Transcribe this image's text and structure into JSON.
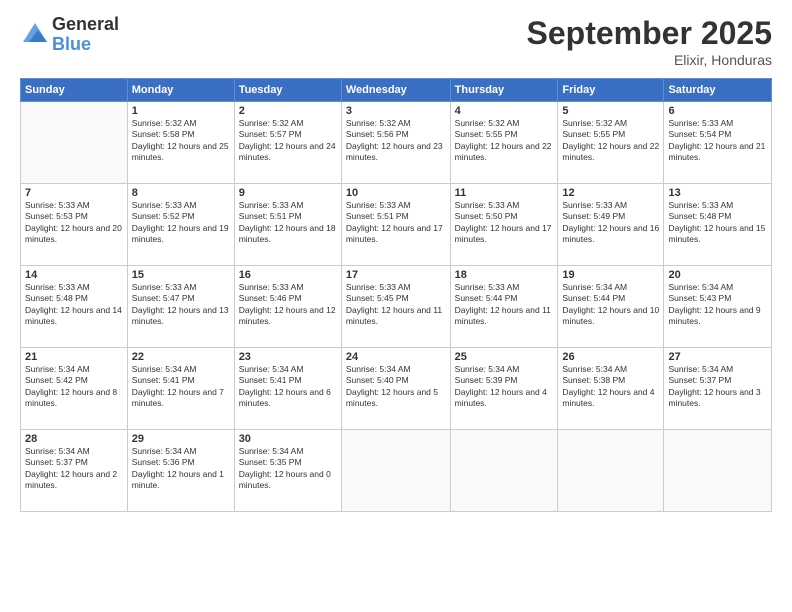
{
  "header": {
    "logo": {
      "general": "General",
      "blue": "Blue"
    },
    "title": "September 2025",
    "location": "Elixir, Honduras"
  },
  "weekdays": [
    "Sunday",
    "Monday",
    "Tuesday",
    "Wednesday",
    "Thursday",
    "Friday",
    "Saturday"
  ],
  "weeks": [
    [
      {
        "day": null
      },
      {
        "day": 1,
        "sunrise": "5:32 AM",
        "sunset": "5:58 PM",
        "daylight": "12 hours and 25 minutes."
      },
      {
        "day": 2,
        "sunrise": "5:32 AM",
        "sunset": "5:57 PM",
        "daylight": "12 hours and 24 minutes."
      },
      {
        "day": 3,
        "sunrise": "5:32 AM",
        "sunset": "5:56 PM",
        "daylight": "12 hours and 23 minutes."
      },
      {
        "day": 4,
        "sunrise": "5:32 AM",
        "sunset": "5:55 PM",
        "daylight": "12 hours and 22 minutes."
      },
      {
        "day": 5,
        "sunrise": "5:32 AM",
        "sunset": "5:55 PM",
        "daylight": "12 hours and 22 minutes."
      },
      {
        "day": 6,
        "sunrise": "5:33 AM",
        "sunset": "5:54 PM",
        "daylight": "12 hours and 21 minutes."
      }
    ],
    [
      {
        "day": 7,
        "sunrise": "5:33 AM",
        "sunset": "5:53 PM",
        "daylight": "12 hours and 20 minutes."
      },
      {
        "day": 8,
        "sunrise": "5:33 AM",
        "sunset": "5:52 PM",
        "daylight": "12 hours and 19 minutes."
      },
      {
        "day": 9,
        "sunrise": "5:33 AM",
        "sunset": "5:51 PM",
        "daylight": "12 hours and 18 minutes."
      },
      {
        "day": 10,
        "sunrise": "5:33 AM",
        "sunset": "5:51 PM",
        "daylight": "12 hours and 17 minutes."
      },
      {
        "day": 11,
        "sunrise": "5:33 AM",
        "sunset": "5:50 PM",
        "daylight": "12 hours and 17 minutes."
      },
      {
        "day": 12,
        "sunrise": "5:33 AM",
        "sunset": "5:49 PM",
        "daylight": "12 hours and 16 minutes."
      },
      {
        "day": 13,
        "sunrise": "5:33 AM",
        "sunset": "5:48 PM",
        "daylight": "12 hours and 15 minutes."
      }
    ],
    [
      {
        "day": 14,
        "sunrise": "5:33 AM",
        "sunset": "5:48 PM",
        "daylight": "12 hours and 14 minutes."
      },
      {
        "day": 15,
        "sunrise": "5:33 AM",
        "sunset": "5:47 PM",
        "daylight": "12 hours and 13 minutes."
      },
      {
        "day": 16,
        "sunrise": "5:33 AM",
        "sunset": "5:46 PM",
        "daylight": "12 hours and 12 minutes."
      },
      {
        "day": 17,
        "sunrise": "5:33 AM",
        "sunset": "5:45 PM",
        "daylight": "12 hours and 11 minutes."
      },
      {
        "day": 18,
        "sunrise": "5:33 AM",
        "sunset": "5:44 PM",
        "daylight": "12 hours and 11 minutes."
      },
      {
        "day": 19,
        "sunrise": "5:34 AM",
        "sunset": "5:44 PM",
        "daylight": "12 hours and 10 minutes."
      },
      {
        "day": 20,
        "sunrise": "5:34 AM",
        "sunset": "5:43 PM",
        "daylight": "12 hours and 9 minutes."
      }
    ],
    [
      {
        "day": 21,
        "sunrise": "5:34 AM",
        "sunset": "5:42 PM",
        "daylight": "12 hours and 8 minutes."
      },
      {
        "day": 22,
        "sunrise": "5:34 AM",
        "sunset": "5:41 PM",
        "daylight": "12 hours and 7 minutes."
      },
      {
        "day": 23,
        "sunrise": "5:34 AM",
        "sunset": "5:41 PM",
        "daylight": "12 hours and 6 minutes."
      },
      {
        "day": 24,
        "sunrise": "5:34 AM",
        "sunset": "5:40 PM",
        "daylight": "12 hours and 5 minutes."
      },
      {
        "day": 25,
        "sunrise": "5:34 AM",
        "sunset": "5:39 PM",
        "daylight": "12 hours and 4 minutes."
      },
      {
        "day": 26,
        "sunrise": "5:34 AM",
        "sunset": "5:38 PM",
        "daylight": "12 hours and 4 minutes."
      },
      {
        "day": 27,
        "sunrise": "5:34 AM",
        "sunset": "5:37 PM",
        "daylight": "12 hours and 3 minutes."
      }
    ],
    [
      {
        "day": 28,
        "sunrise": "5:34 AM",
        "sunset": "5:37 PM",
        "daylight": "12 hours and 2 minutes."
      },
      {
        "day": 29,
        "sunrise": "5:34 AM",
        "sunset": "5:36 PM",
        "daylight": "12 hours and 1 minute."
      },
      {
        "day": 30,
        "sunrise": "5:34 AM",
        "sunset": "5:35 PM",
        "daylight": "12 hours and 0 minutes."
      },
      {
        "day": null
      },
      {
        "day": null
      },
      {
        "day": null
      },
      {
        "day": null
      }
    ]
  ]
}
